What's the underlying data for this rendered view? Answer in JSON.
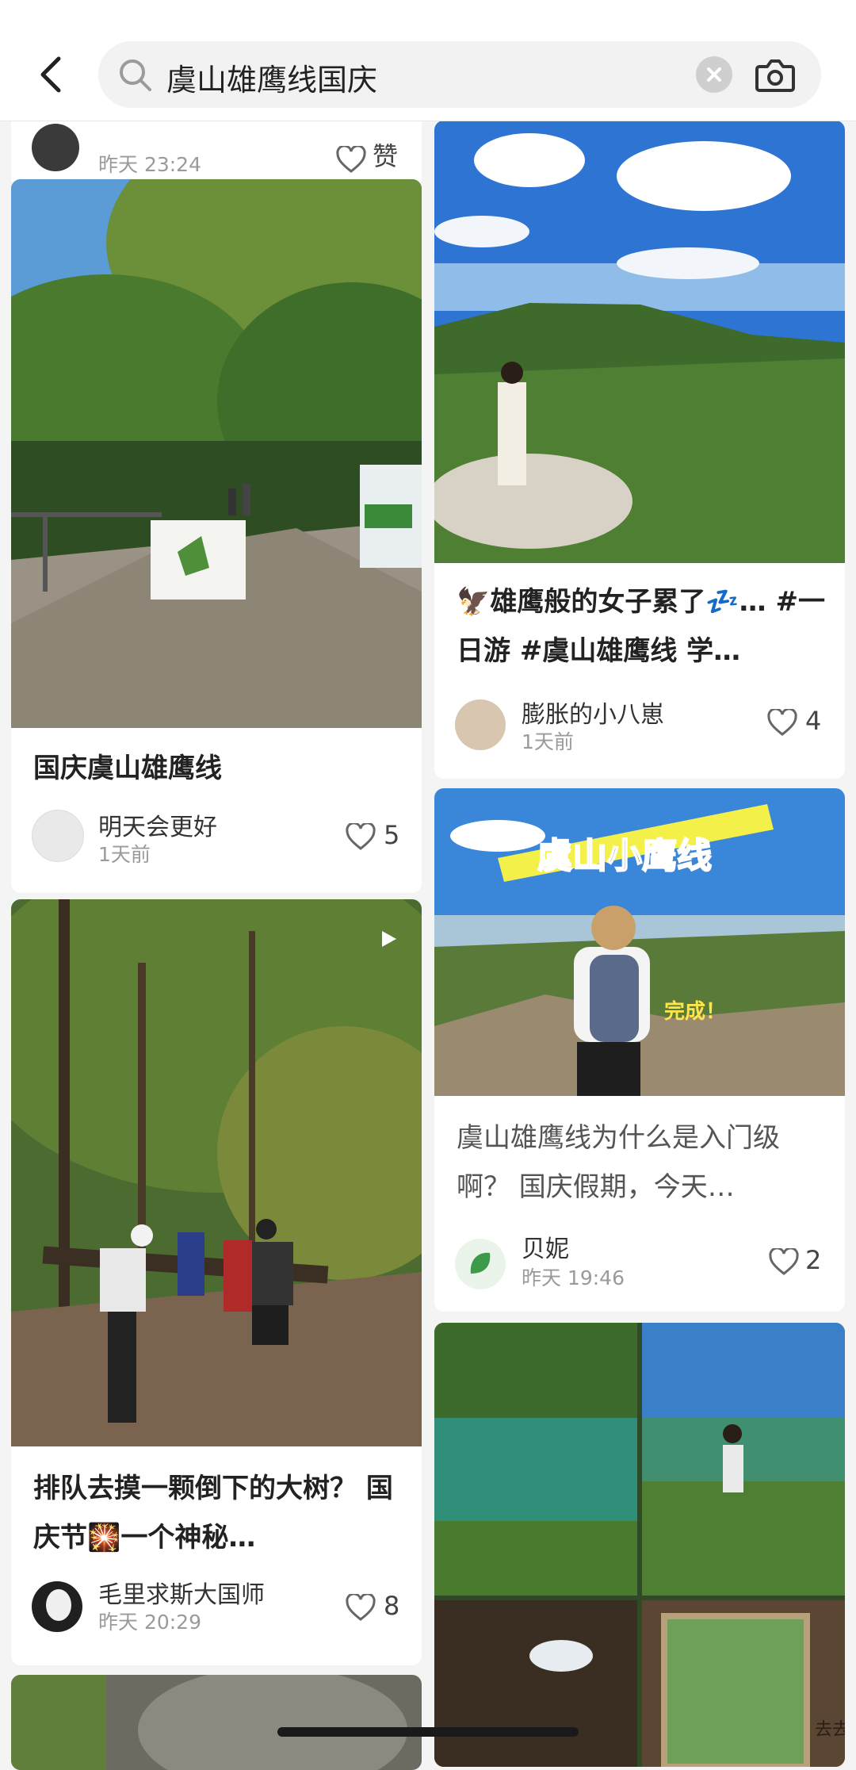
{
  "search": {
    "query": "虞山雄鹰线国庆"
  },
  "left_top": {
    "time": "昨天 23:24",
    "likes": "赞"
  },
  "cards": {
    "l1": {
      "title": "国庆虞山雄鹰线",
      "author": "明天会更好",
      "time": "1天前",
      "likes": "5"
    },
    "l2": {
      "title": "排队去摸一颗倒下的大树？ 国庆节🎇一个神秘…",
      "author": "毛里求斯大国师",
      "time": "昨天 20:29",
      "likes": "8"
    },
    "r1": {
      "title": "🦅雄鹰般的女子累了💤… #一日游 #虞山雄鹰线 学…",
      "author": "膨胀的小八崽",
      "time": "1天前",
      "likes": "4"
    },
    "r2": {
      "title": "虞山雄鹰线为什么是入门级啊？ 国庆假期，今天…",
      "author": "贝妮",
      "time": "昨天 19:46",
      "likes": "2",
      "overlay": "虞山小鹰线",
      "badge": "完成！"
    },
    "r3": {
      "overlay": "去去山野"
    }
  },
  "colors": {
    "sky": "#3e7fd6",
    "forest": "#3c6b2c",
    "lake": "#2f8f78"
  }
}
